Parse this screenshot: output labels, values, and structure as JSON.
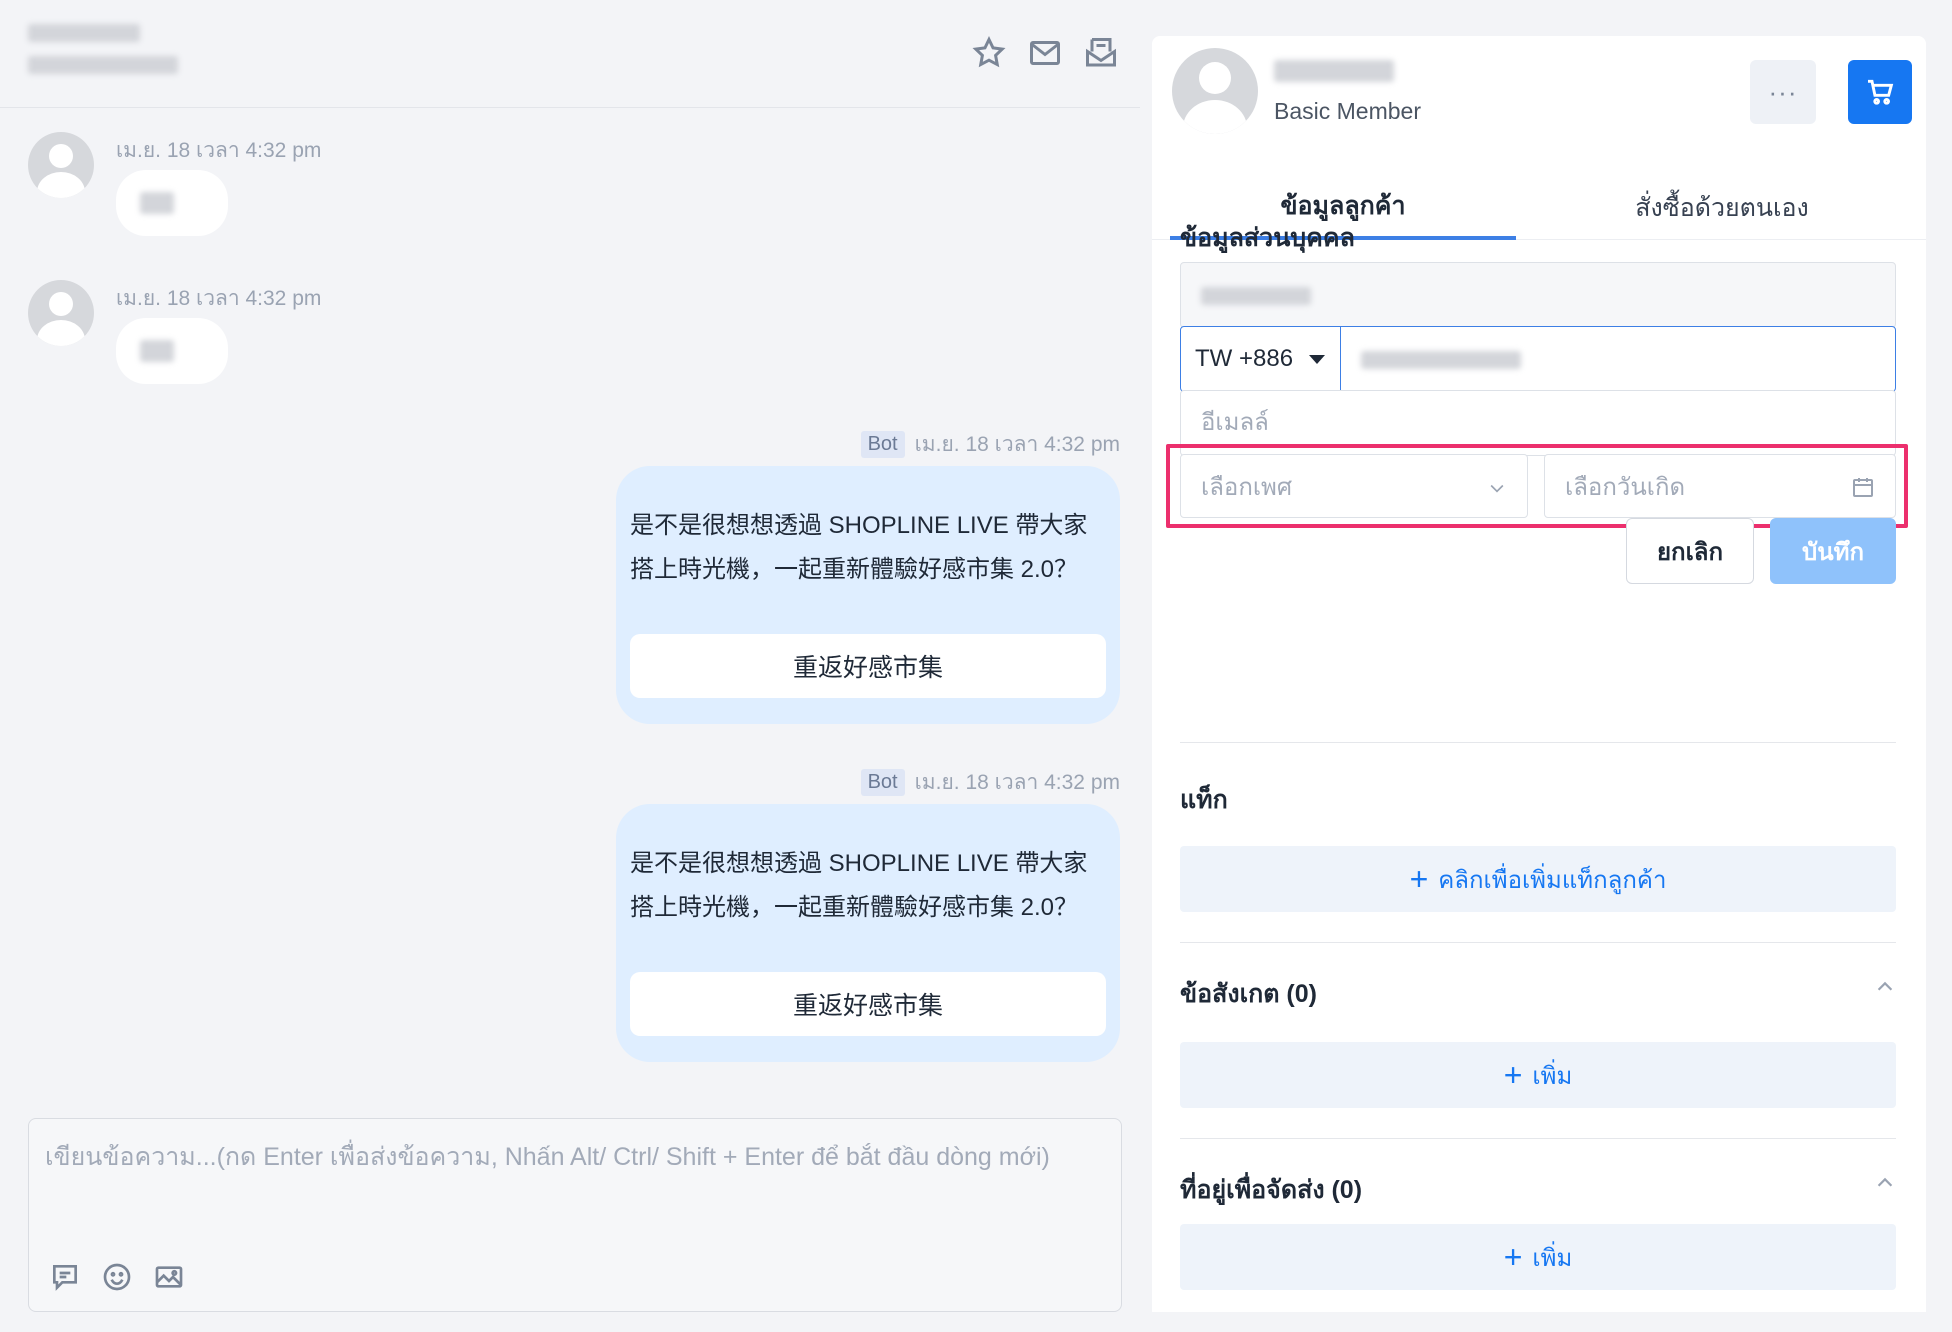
{
  "chat": {
    "messages_in": [
      {
        "time": "เม.ย. 18 เวลา 4:32 pm"
      },
      {
        "time": "เม.ย. 18 เวลา 4:32 pm"
      }
    ],
    "messages_out": [
      {
        "badge": "Bot",
        "time": "เม.ย. 18 เวลา 4:32 pm",
        "text": "是不是很想想透過 SHOPLINE LIVE 帶大家搭上時光機，一起重新體驗好感市集 2.0？",
        "button": "重返好感市集"
      },
      {
        "badge": "Bot",
        "time": "เม.ย. 18 เวลา 4:32 pm",
        "text": "是不是很想想透過 SHOPLINE LIVE 帶大家搭上時光機，一起重新體驗好感市集 2.0？",
        "button": "重返好感市集"
      }
    ],
    "composer": {
      "placeholder": "เขียนข้อความ...(กด Enter เพื่อส่งข้อความ, Nhấn Alt/ Ctrl/ Shift + Enter để bắt đầu dòng mới)",
      "icons": [
        "quick-reply-icon",
        "emoji-icon",
        "image-icon"
      ]
    },
    "header_icons": [
      "star-icon",
      "mail-icon",
      "inbox-icon"
    ]
  },
  "customer": {
    "member_level": "Basic Member",
    "more_label": "···",
    "tabs": [
      "ข้อมูลลูกค้า",
      "สั่งซื้อด้วยตนเอง"
    ],
    "personal": {
      "title": "ข้อมูลส่วนบุคคล",
      "phone_code": "TW +886",
      "email_placeholder": "อีเมลล์",
      "gender_placeholder": "เลือกเพศ",
      "birthday_placeholder": "เลือกวันเกิด",
      "cancel": "ยกเลิก",
      "save": "บันทึก"
    },
    "tags": {
      "title": "แท็ก",
      "add_label": "คลิกเพื่อเพิ่มแท็กลูกค้า"
    },
    "notes": {
      "title": "ข้อสังเกต (0)",
      "add_label": "เพิ่ม"
    },
    "addresses": {
      "title": "ที่อยู่เพื่อจัดส่ง (0)",
      "add_label": "เพิ่ม"
    }
  },
  "colors": {
    "accent": "#1677f2",
    "highlight": "#ec2f6d",
    "bot_bubble": "#dfeeff"
  }
}
